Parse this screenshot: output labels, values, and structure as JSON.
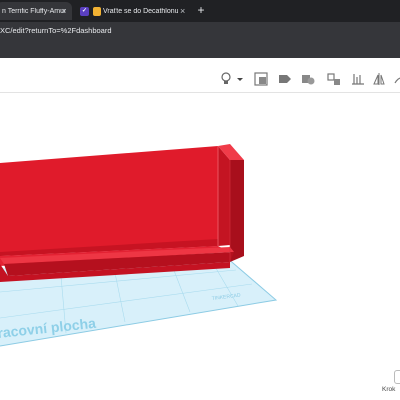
{
  "browser": {
    "tabs": [
      {
        "label": "n Terrific Fluffy-Amur",
        "active": true
      },
      {
        "label": "Vraťte se do Decathlonu a",
        "active": false
      }
    ],
    "close_symbol": "×",
    "new_tab_symbol": "+",
    "url": "XC/edit?returnTo=%2Fdashboard"
  },
  "toolbar": {
    "tools": [
      {
        "name": "lightbulb-icon"
      },
      {
        "name": "dropdown-caret-icon"
      },
      {
        "name": "note-icon"
      },
      {
        "name": "shapes-icon"
      },
      {
        "name": "group-icon"
      },
      {
        "name": "ungroup-icon"
      },
      {
        "name": "align-icon"
      },
      {
        "name": "mirror-icon"
      },
      {
        "name": "cruise-icon"
      },
      {
        "name": "workplane-icon"
      }
    ]
  },
  "workplane": {
    "label": "racovní plocha",
    "logo_text": "TINKERCAD",
    "colors": {
      "grid": "#cfeaf5",
      "grid_line": "#9fd3ea",
      "object_front": "#e81c2c",
      "object_dark": "#b3111f",
      "object_light": "#f04552"
    }
  },
  "status": {
    "step_label": "Krok"
  }
}
